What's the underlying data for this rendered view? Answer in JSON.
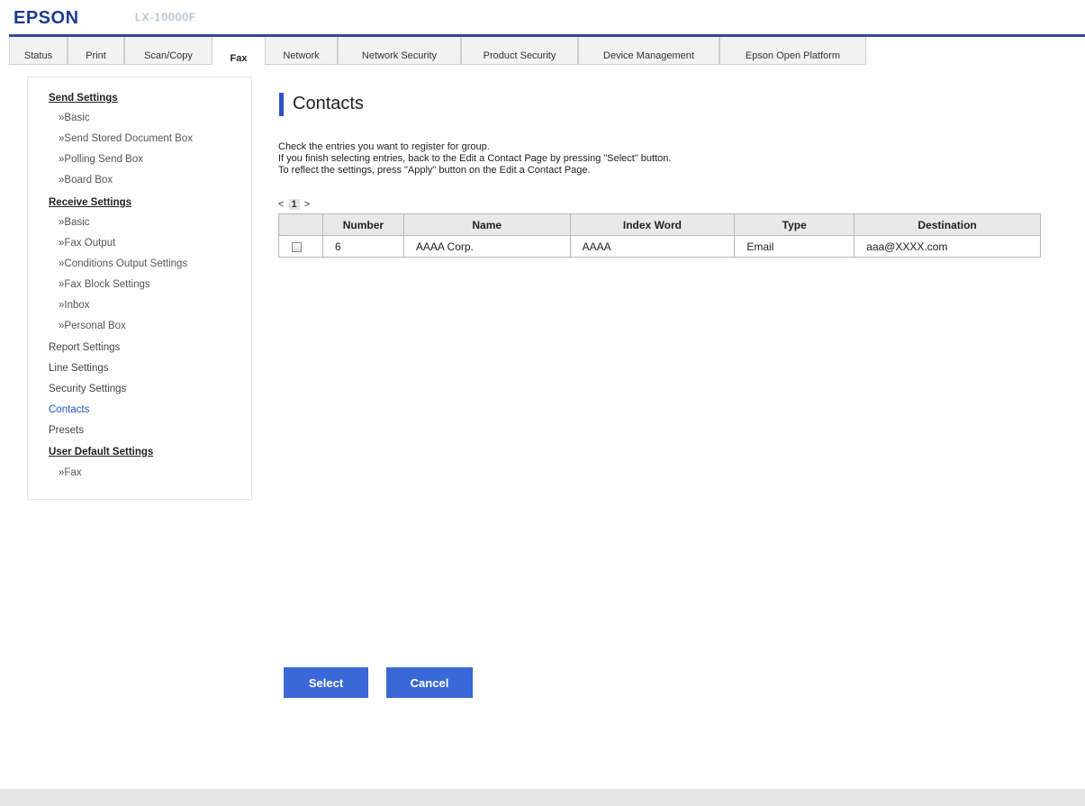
{
  "header": {
    "logo": "EPSON",
    "model": "LX-10000F",
    "accent_color": "#2f4a9e"
  },
  "tabs": [
    {
      "label": "Status",
      "active": false
    },
    {
      "label": "Print",
      "active": false
    },
    {
      "label": "Scan/Copy",
      "active": false
    },
    {
      "label": "Fax",
      "active": true
    },
    {
      "label": "Network",
      "active": false
    },
    {
      "label": "Network Security",
      "active": false
    },
    {
      "label": "Product Security",
      "active": false
    },
    {
      "label": "Device Management",
      "active": false
    },
    {
      "label": "Epson Open Platform",
      "active": false
    }
  ],
  "sidebar": {
    "send_settings": "Send Settings",
    "send_basic": "»Basic",
    "send_stored": "»Send Stored Document Box",
    "polling_send": "»Polling Send Box",
    "board_box": "»Board Box",
    "receive_settings": "Receive Settings",
    "receive_basic": "»Basic",
    "fax_output": "»Fax Output",
    "conditions_output": "»Conditions Output Settings",
    "fax_block": "»Fax Block Settings",
    "inbox": "»Inbox",
    "personal_box": "»Personal Box",
    "report_settings": "Report Settings",
    "line_settings": "Line Settings",
    "security_settings": "Security Settings",
    "contacts": "Contacts",
    "presets": "Presets",
    "user_default": "User Default Settings",
    "user_default_fax": "»Fax"
  },
  "main": {
    "title": "Contacts",
    "desc1": "Check the entries you want to register for group.",
    "desc2": "If you finish selecting entries, back to the Edit a Contact Page by pressing \"Select\" button.",
    "desc3": "To reflect the settings, press \"Apply\" button on the Edit a Contact Page.",
    "pager_prev": "<",
    "pager_current": "1",
    "pager_next": ">"
  },
  "table": {
    "headers": {
      "number": "Number",
      "name": "Name",
      "index_word": "Index Word",
      "type": "Type",
      "destination": "Destination"
    },
    "rows": [
      {
        "checked": false,
        "number": "6",
        "name": "AAAA Corp.",
        "index_word": "AAAA",
        "type": "Email",
        "destination": "aaa@XXXX.com"
      }
    ]
  },
  "buttons": {
    "select": "Select",
    "cancel": "Cancel",
    "button_color": "#3a68d8"
  }
}
